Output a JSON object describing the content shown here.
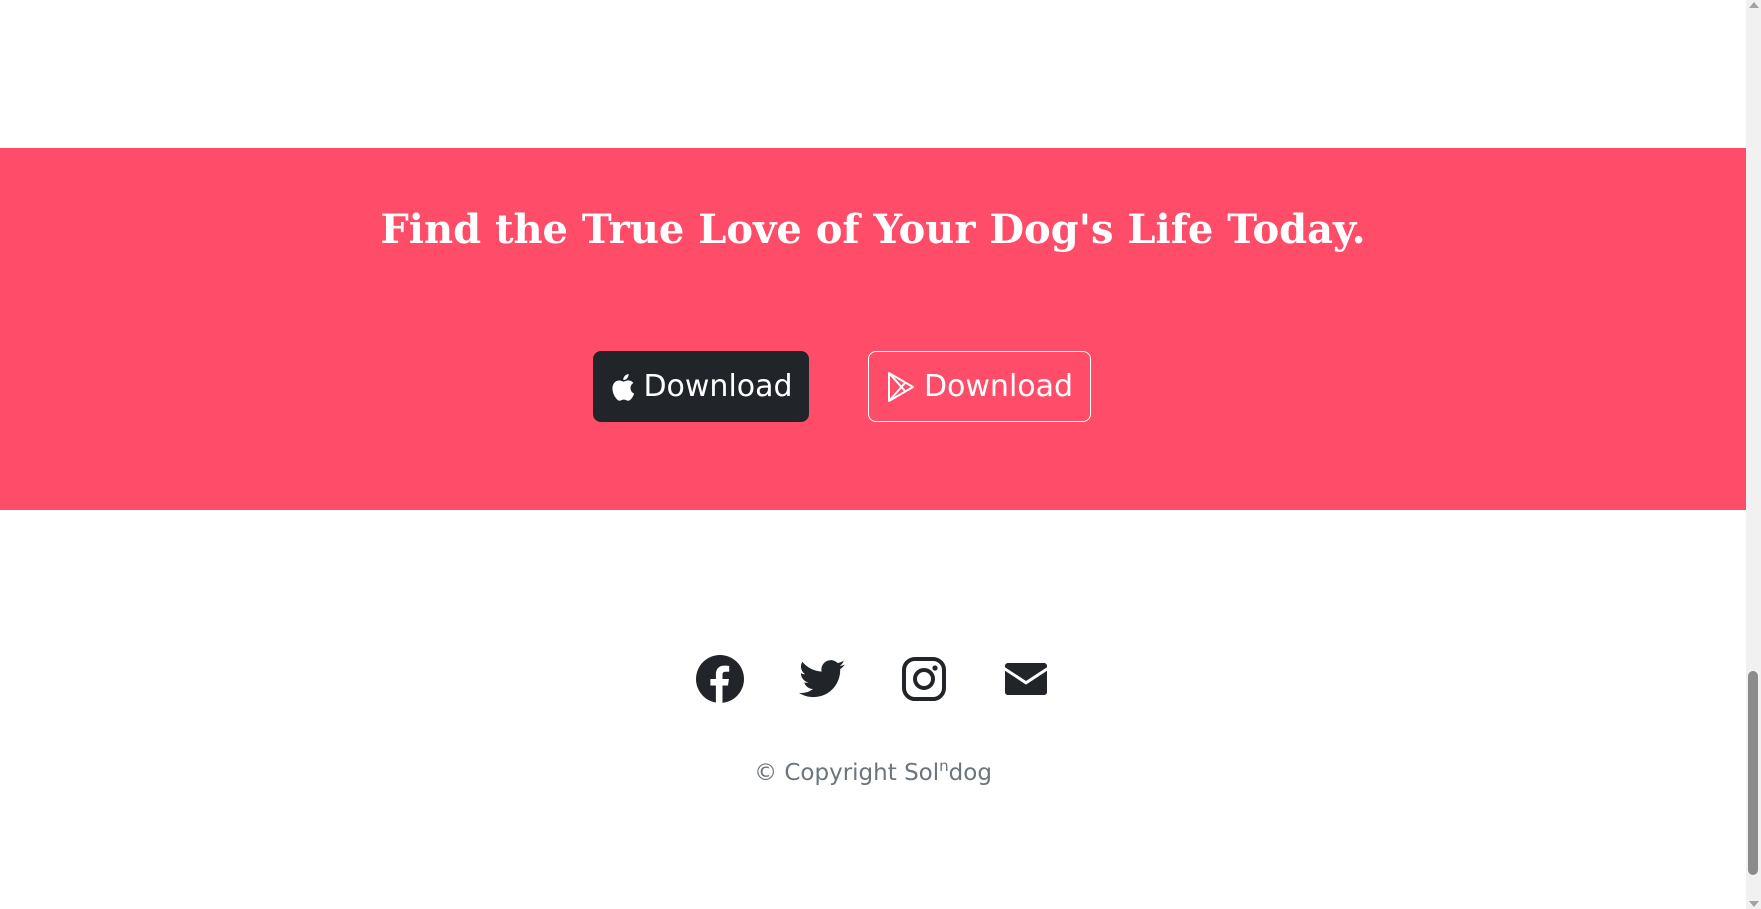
{
  "cta": {
    "title": "Find the True Love of Your Dog's Life Today.",
    "apple_button_label": "Download",
    "google_button_label": "Download"
  },
  "footer": {
    "social_icons": [
      "facebook-icon",
      "twitter-icon",
      "instagram-icon",
      "envelope-icon"
    ],
    "copyright_prefix": "© Copyright Sol",
    "copyright_sup": "n",
    "copyright_suffix": "dog"
  },
  "colors": {
    "brand_pink": "#ff4c68",
    "dark_button": "#212529",
    "icon_dark": "#212529",
    "muted_text": "#6c757d"
  }
}
